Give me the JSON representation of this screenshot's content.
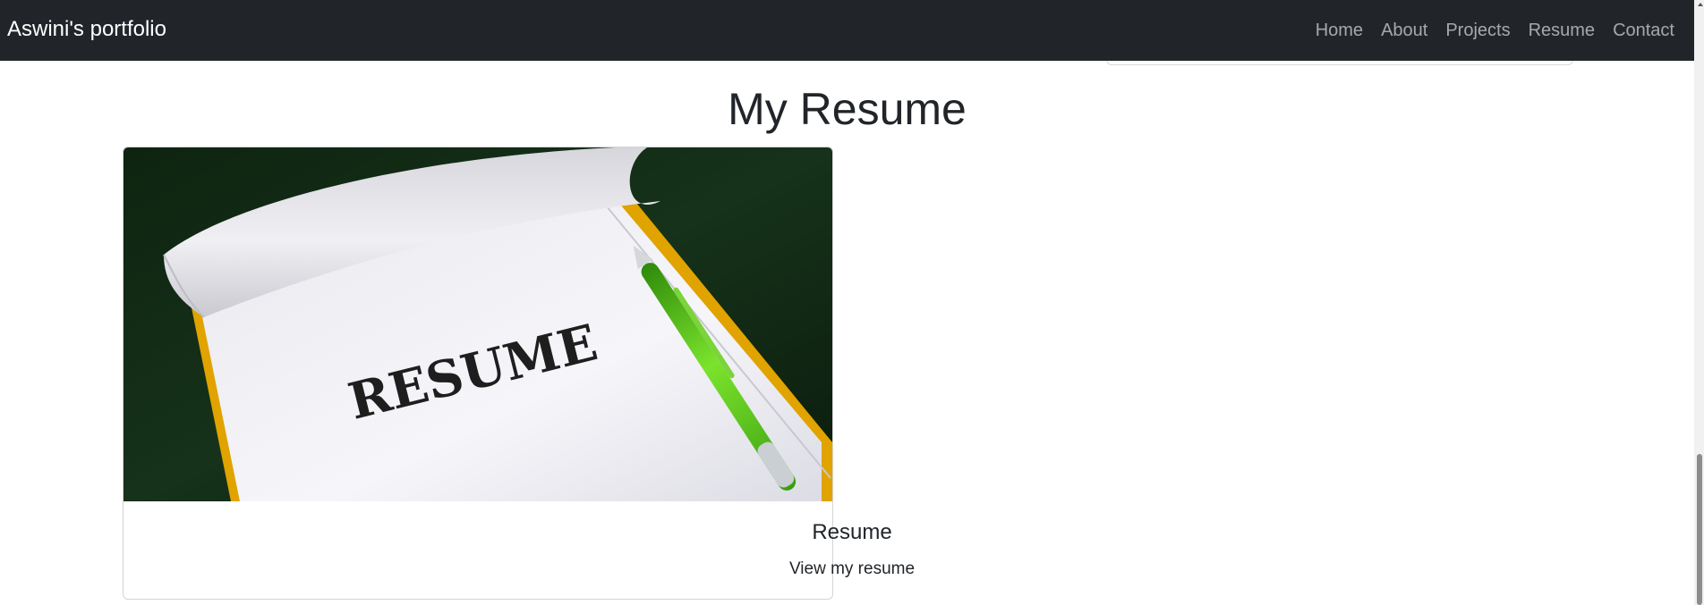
{
  "navbar": {
    "brand": "Aswini's portfolio",
    "links": [
      {
        "label": "Home"
      },
      {
        "label": "About"
      },
      {
        "label": "Projects"
      },
      {
        "label": "Resume"
      },
      {
        "label": "Contact"
      }
    ]
  },
  "main": {
    "title": "My Resume",
    "card": {
      "image_word": "RESUME",
      "title": "Resume",
      "text": "View my resume"
    }
  },
  "colors": {
    "navbar_bg": "#212529",
    "nav_link": "#9a9da0",
    "pen_green": "#5cc21a",
    "pad_yellow": "#e1a800"
  }
}
